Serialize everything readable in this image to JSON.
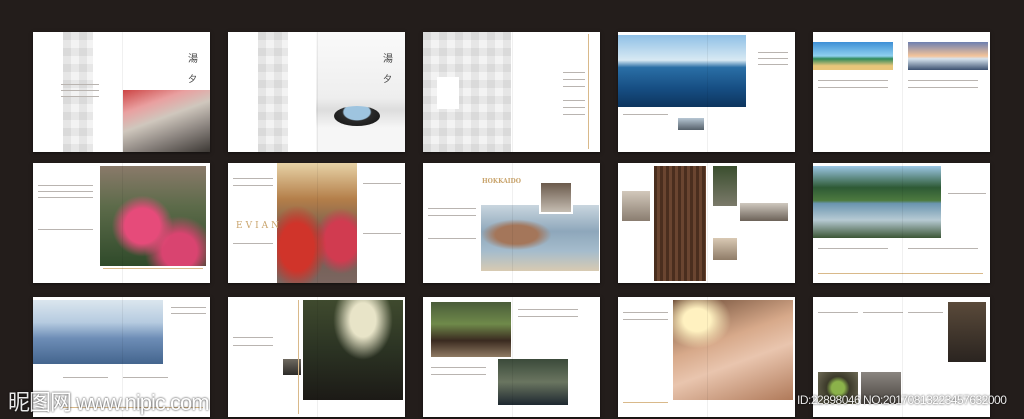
{
  "brochure": {
    "cover_title_1": "湯",
    "cover_title_2": "夕",
    "spread_hokkaido_title": "HOKKAIDO",
    "spread_evian_title": "EVIAN"
  },
  "watermark": {
    "site": "昵图网 www.nipic.com",
    "id": "ID:22898046 NO:20170813223457632000"
  },
  "colors": {
    "background": "#231d1b",
    "accent": "#d9b98a"
  }
}
